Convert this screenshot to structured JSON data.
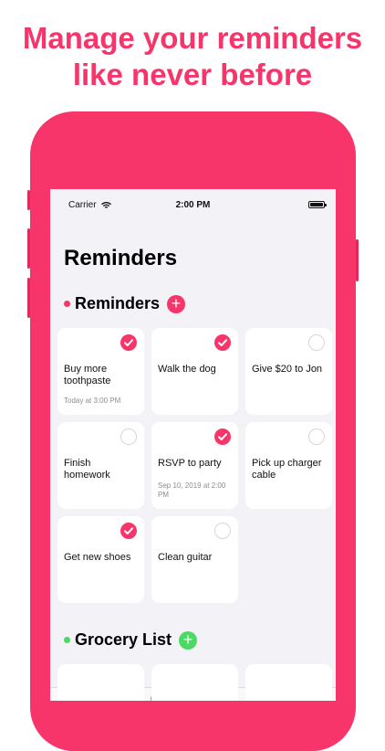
{
  "headline": {
    "line1": "Manage your reminders",
    "line2": "like never before"
  },
  "status_bar": {
    "carrier": "Carrier",
    "time": "2:00 PM"
  },
  "page_title": "Reminders",
  "sections": [
    {
      "name": "Reminders",
      "color": "#f7356a",
      "cards": [
        {
          "title": "Buy more toothpaste",
          "meta": "Today at 3:00 PM",
          "checked": true
        },
        {
          "title": "Walk the dog",
          "meta": "",
          "checked": true
        },
        {
          "title": "Give $20 to Jon",
          "meta": "",
          "checked": false
        },
        {
          "title": "Finish homework",
          "meta": "",
          "checked": false
        },
        {
          "title": "RSVP to party",
          "meta": "Sep 10, 2019 at 2:00 PM",
          "checked": true
        },
        {
          "title": "Pick up charger cable",
          "meta": "",
          "checked": false
        },
        {
          "title": "Get new shoes",
          "meta": "",
          "checked": true
        },
        {
          "title": "Clean guitar",
          "meta": "",
          "checked": false
        }
      ]
    },
    {
      "name": "Grocery List",
      "color": "#4cd964",
      "cards": []
    }
  ],
  "add_glyph": "+",
  "colors": {
    "accent": "#f7356a",
    "green": "#4cd964",
    "screen_bg": "#f2f2f7"
  }
}
